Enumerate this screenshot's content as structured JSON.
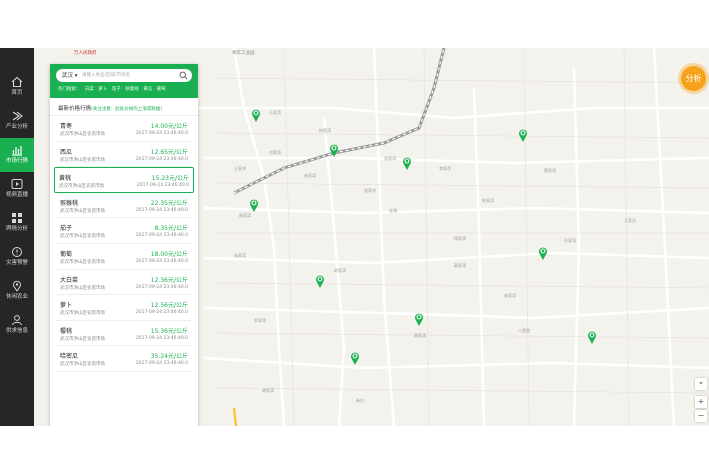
{
  "sidebar": {
    "items": [
      {
        "label": "首页",
        "icon": "home-icon"
      },
      {
        "label": "产业分析",
        "icon": "chevron-right-icon"
      },
      {
        "label": "市场行情",
        "icon": "bar-chart-icon",
        "active": true
      },
      {
        "label": "视频直播",
        "icon": "play-icon"
      },
      {
        "label": "舆情分析",
        "icon": "grid-icon"
      },
      {
        "label": "灾害预警",
        "icon": "warning-icon"
      },
      {
        "label": "休闲农业",
        "icon": "location-icon"
      },
      {
        "label": "供求信息",
        "icon": "user-icon"
      }
    ]
  },
  "map_top": {
    "label_left": "万人民政府",
    "label_center": "青年工业园"
  },
  "search": {
    "city": "武汉",
    "placeholder": "请输入地名/区域/市场名",
    "hot_label": "热门搜索：",
    "hot_items": [
      "白菜",
      "萝卜",
      "茄子",
      "秋葵线",
      "黄瓜",
      "葡萄"
    ]
  },
  "list": {
    "title": "最新价格行情",
    "note": "(关注注意：此处价格的上涨或跌幅)",
    "rows": [
      {
        "name": "青枣",
        "price": "14.00元/公斤",
        "market": "武汉市洪山区农贸市场",
        "time": "2017-09-24 23:46:40.0"
      },
      {
        "name": "西瓜",
        "price": "12.65元/公斤",
        "market": "武汉市洪山区农贸市场",
        "time": "2017-09-24 23:46:40.0"
      },
      {
        "name": "黄桃",
        "price": "15.23元/公斤",
        "market": "武汉市洪山区农贸市场",
        "time": "2017-09-24 23:46:40.0"
      },
      {
        "name": "猕猴桃",
        "price": "22.35元/公斤",
        "market": "武汉市洪山区农贸市场",
        "time": "2017-09-24 23:46:40.0"
      },
      {
        "name": "茄子",
        "price": "8.35元/公斤",
        "market": "武汉市洪山区农贸市场",
        "time": "2017-09-24 23:46:40.0"
      },
      {
        "name": "葡萄",
        "price": "18.00元/公斤",
        "market": "武汉市洪山区农贸市场",
        "time": "2017-09-24 23:46:40.0"
      },
      {
        "name": "大白菜",
        "price": "12.36元/公斤",
        "market": "武汉市洪山区农贸市场",
        "time": "2017-09-24 23:46:40.0"
      },
      {
        "name": "萝卜",
        "price": "12.56元/公斤",
        "market": "武汉市洪山区农贸市场",
        "time": "2017-09-24 23:46:40.0"
      },
      {
        "name": "樱桃",
        "price": "15.36元/公斤",
        "market": "武汉市洪山区农贸市场",
        "time": "2017-09-24 23:46:40.0"
      },
      {
        "name": "哈密瓜",
        "price": "35.24元/公斤",
        "market": "武汉市洪山区农贸市场",
        "time": "2017-09-24 23:46:40.0"
      }
    ]
  },
  "analyze_button": "分析",
  "map_controls": {
    "zoom_in": "+",
    "zoom_out": "−"
  },
  "map_labels": [
    "王家湾",
    "何家湾",
    "刘家湾",
    "吴家湾",
    "王家冲",
    "赵家湾",
    "李家湾",
    "黄家湾",
    "张家冲",
    "陈家湾",
    "周家湾",
    "杨家湾",
    "孙家湾",
    "朱家湾",
    "胡家湾",
    "郭家湾",
    "林家湾",
    "罗家湾",
    "高家湾",
    "谢家湾",
    "新村",
    "八里堂",
    "金湖",
    "王家台"
  ],
  "colors": {
    "accent": "#1aaf51",
    "orange": "#f7a21b",
    "sidebar": "#262626"
  }
}
